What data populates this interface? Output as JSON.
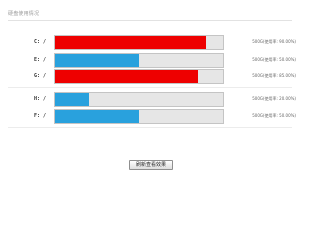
{
  "page": {
    "title": "硬盘使用情况",
    "action_button_label": "刷新查看效果"
  },
  "colors": {
    "high_usage": "#ee0000",
    "normal_usage": "#29a1dd",
    "track": "#e6e6e6"
  },
  "drives": [
    {
      "label": "C: /",
      "usage_percent": 90,
      "status": "high",
      "caption": "500G(使用率: 90.00%)"
    },
    {
      "label": "E: /",
      "usage_percent": 50,
      "status": "normal",
      "caption": "500G(使用率: 50.00%)"
    },
    {
      "label": "G: /",
      "usage_percent": 85,
      "status": "high",
      "caption": "500G(使用率: 85.00%)"
    },
    {
      "label": "H: /",
      "usage_percent": 20,
      "status": "normal",
      "caption": "500G(使用率: 20.00%)"
    },
    {
      "label": "F: /",
      "usage_percent": 50,
      "status": "normal",
      "caption": "500G(使用率: 50.00%)"
    }
  ]
}
